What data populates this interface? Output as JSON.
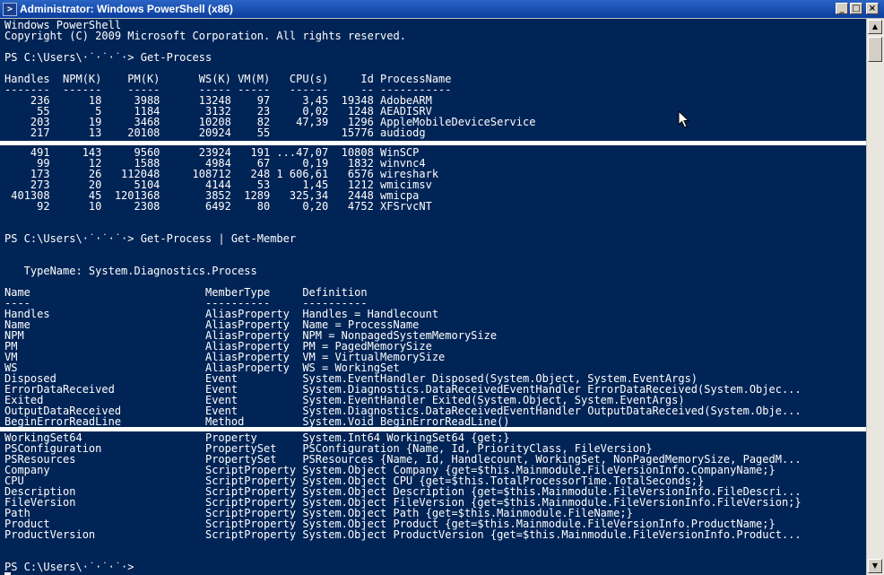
{
  "window": {
    "title": "Administrator: Windows PowerShell (x86)",
    "controls": {
      "minimize": "_",
      "maximize": "□",
      "close": "×"
    }
  },
  "icons": {
    "app": "powershell-icon",
    "cursor": "mouse-pointer-icon"
  },
  "colors": {
    "console_bg": "#012456",
    "console_fg": "#ffffff",
    "title_bar": "#0a3e9e"
  },
  "console": {
    "segment1": [
      "Windows PowerShell",
      "Copyright (C) 2009 Microsoft Corporation. All rights reserved.",
      "",
      "PS C:\\Users\\·˙·˙·˙·> Get-Process",
      "",
      "Handles  NPM(K)    PM(K)      WS(K) VM(M)   CPU(s)     Id ProcessName",
      "-------  ------    -----      ----- -----   ------     -- -----------",
      "    236      18     3988      13248    97     3,45  19348 AdobeARM",
      "     55       5     1184       3132    23     0,02   1248 AEADISRV",
      "    203      19     3468      10208    82    47,39   1296 AppleMobileDeviceService",
      "    217      13    20108      20924    55           15776 audiodg"
    ],
    "segment2": [
      "    491     143     9560      23924   191 ...47,07  10808 WinSCP",
      "     99      12     1588       4984    67     0,19   1832 winvnc4",
      "    173      26   112048     108712   248 1 606,61   6576 wireshark",
      "    273      20     5104       4144    53     1,45   1212 wmicimsv",
      " 401308      45  1201368       3852  1289   325,34   2448 wmicpa",
      "     92      10     2308       6492    80     0,20   4752 XFSrvcNT",
      "",
      "",
      "PS C:\\Users\\·˙·˙·˙·> Get-Process | Get-Member",
      "",
      "",
      "   TypeName: System.Diagnostics.Process",
      "",
      "Name                           MemberType     Definition",
      "----                           ----------     ----------",
      "Handles                        AliasProperty  Handles = Handlecount",
      "Name                           AliasProperty  Name = ProcessName",
      "NPM                            AliasProperty  NPM = NonpagedSystemMemorySize",
      "PM                             AliasProperty  PM = PagedMemorySize",
      "VM                             AliasProperty  VM = VirtualMemorySize",
      "WS                             AliasProperty  WS = WorkingSet",
      "Disposed                       Event          System.EventHandler Disposed(System.Object, System.EventArgs)",
      "ErrorDataReceived              Event          System.Diagnostics.DataReceivedEventHandler ErrorDataReceived(System.Objec...",
      "Exited                         Event          System.EventHandler Exited(System.Object, System.EventArgs)",
      "OutputDataReceived             Event          System.Diagnostics.DataReceivedEventHandler OutputDataReceived(System.Obje...",
      "BeginErrorReadLine             Method         System.Void BeginErrorReadLine()"
    ],
    "segment3": [
      "WorkingSet64                   Property       System.Int64 WorkingSet64 {get;}",
      "PSConfiguration                PropertySet    PSConfiguration {Name, Id, PriorityClass, FileVersion}",
      "PSResources                    PropertySet    PSResources {Name, Id, Handlecount, WorkingSet, NonPagedMemorySize, PagedM...",
      "Company                        ScriptProperty System.Object Company {get=$this.Mainmodule.FileVersionInfo.CompanyName;}",
      "CPU                            ScriptProperty System.Object CPU {get=$this.TotalProcessorTime.TotalSeconds;}",
      "Description                    ScriptProperty System.Object Description {get=$this.Mainmodule.FileVersionInfo.FileDescri...",
      "FileVersion                    ScriptProperty System.Object FileVersion {get=$this.Mainmodule.FileVersionInfo.FileVersion;}",
      "Path                           ScriptProperty System.Object Path {get=$this.Mainmodule.FileName;}",
      "Product                        ScriptProperty System.Object Product {get=$this.Mainmodule.FileVersionInfo.ProductName;}",
      "ProductVersion                 ScriptProperty System.Object ProductVersion {get=$this.Mainmodule.FileVersionInfo.Product...",
      "",
      ""
    ],
    "prompt": "PS C:\\Users\\·˙·˙·˙·> "
  }
}
